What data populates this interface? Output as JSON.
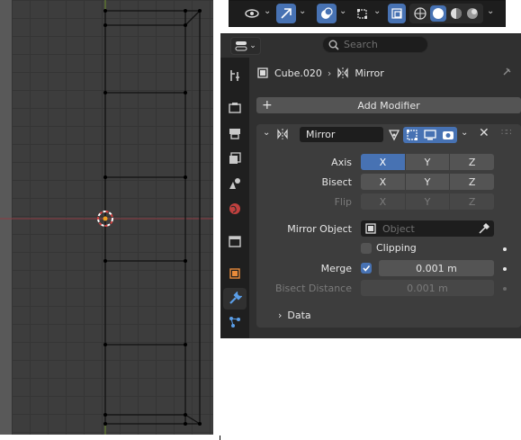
{
  "viewport": {
    "grid_on": true
  },
  "viewport_header": {
    "buttons": [
      {
        "icon": "eye-icon",
        "active": false,
        "has_dropdown": true
      },
      {
        "icon": "gizmo-icon",
        "active": true,
        "has_dropdown": true
      },
      {
        "icon": "overlays-icon",
        "active": true,
        "has_dropdown": true
      },
      {
        "icon": "mesh-edit-overlays-icon",
        "active": false,
        "has_dropdown": true
      },
      {
        "icon": "xray-icon",
        "active": true,
        "has_dropdown": false
      },
      {
        "icon": "shading-modes-icon",
        "active": false,
        "has_dropdown": true
      }
    ]
  },
  "properties": {
    "search": {
      "placeholder": "Search"
    },
    "breadcrumb": {
      "object": "Cube.020",
      "modifier": "Mirror"
    },
    "tabs": [
      {
        "icon": "tool-icon",
        "active": false
      },
      {
        "icon": "render-icon",
        "active": false
      },
      {
        "icon": "output-icon",
        "active": false
      },
      {
        "icon": "view-layer-icon",
        "active": false
      },
      {
        "icon": "scene-icon",
        "active": false
      },
      {
        "icon": "world-icon",
        "active": false
      },
      {
        "icon": "collection-icon",
        "active": false
      },
      {
        "icon": "object-icon",
        "active": false
      },
      {
        "icon": "wrench-icon",
        "active": true
      },
      {
        "icon": "particles-icon",
        "active": false
      }
    ],
    "add_modifier": "Add Modifier",
    "modifier": {
      "name": "Mirror",
      "axis": {
        "label": "Axis",
        "options": [
          "X",
          "Y",
          "Z"
        ],
        "active": [
          "X"
        ]
      },
      "bisect": {
        "label": "Bisect",
        "options": [
          "X",
          "Y",
          "Z"
        ],
        "active": []
      },
      "flip": {
        "label": "Flip",
        "options": [
          "X",
          "Y",
          "Z"
        ],
        "active": [],
        "disabled": true
      },
      "mirror_object": {
        "label": "Mirror Object",
        "placeholder": "Object"
      },
      "clipping": {
        "label": "Clipping",
        "checked": false
      },
      "merge": {
        "label": "Merge",
        "checked": true,
        "value": "0.001 m"
      },
      "bisect_distance": {
        "label": "Bisect Distance",
        "value": "0.001 m",
        "disabled": true
      },
      "data_subpanel": "Data"
    },
    "colors": {
      "accent": "#4772b3",
      "panel": "#3d3d3d",
      "background": "#303030"
    }
  }
}
